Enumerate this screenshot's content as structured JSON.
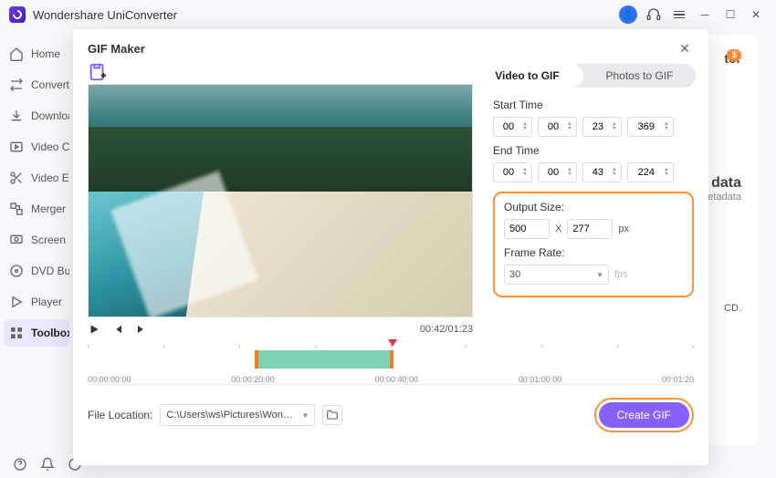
{
  "app": {
    "title": "Wondershare UniConverter"
  },
  "sidebar": {
    "items": [
      {
        "label": "Home"
      },
      {
        "label": "Converter"
      },
      {
        "label": "Downloader"
      },
      {
        "label": "Video Compressor"
      },
      {
        "label": "Video Editor"
      },
      {
        "label": "Merger"
      },
      {
        "label": "Screen Recorder"
      },
      {
        "label": "DVD Burner"
      },
      {
        "label": "Player"
      },
      {
        "label": "Toolbox"
      }
    ]
  },
  "back": {
    "heading_tail": "tor",
    "data_tail": "data",
    "etadata": "etadata",
    "cd": "CD."
  },
  "modal": {
    "title": "GIF Maker",
    "tabs": {
      "video": "Video to GIF",
      "photos": "Photos to GIF"
    },
    "time": {
      "start_label": "Start Time",
      "end_label": "End Time",
      "start": {
        "h": "00",
        "m": "00",
        "s": "23",
        "ms": "369"
      },
      "end": {
        "h": "00",
        "m": "00",
        "s": "43",
        "ms": "224"
      }
    },
    "output": {
      "size_label": "Output Size:",
      "w": "500",
      "x": "X",
      "h": "277",
      "px": "px",
      "rate_label": "Frame Rate:",
      "rate": "30",
      "fps": "fps"
    },
    "playhead": {
      "current": "00:42",
      "total": "01:23"
    },
    "timeline": {
      "marks": [
        "00:00:00:00",
        "00:00:20:00",
        "00:00:40:00",
        "00:01:00:00",
        "00:01:20"
      ]
    },
    "file": {
      "label": "File Location:",
      "path": "C:\\Users\\ws\\Pictures\\Wonders"
    },
    "create": "Create GIF"
  }
}
